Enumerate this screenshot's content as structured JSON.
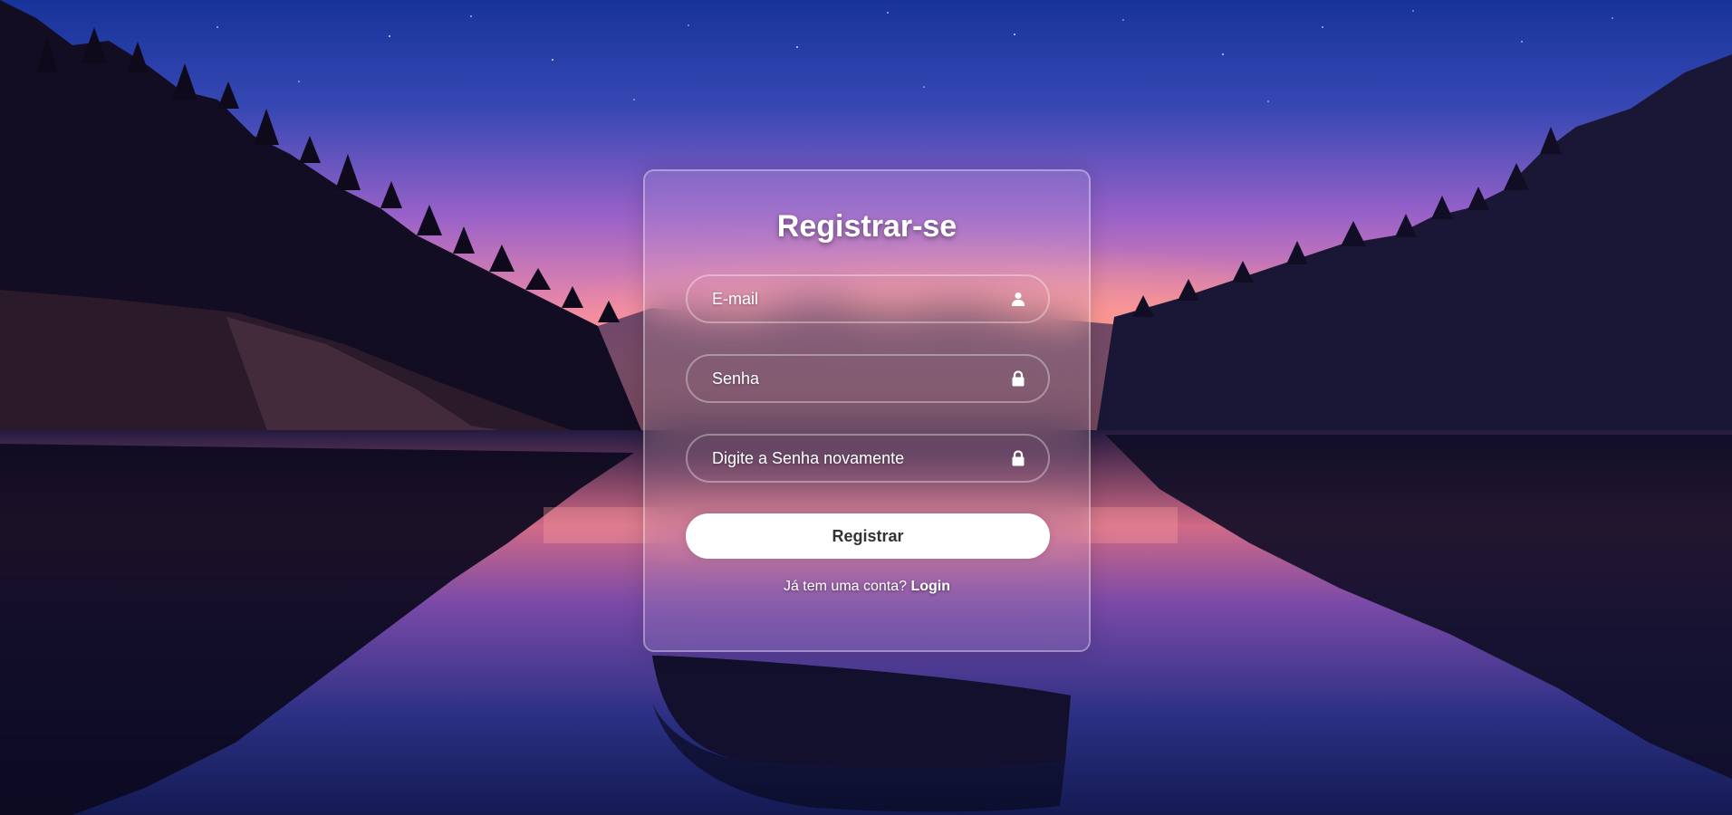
{
  "form": {
    "title": "Registrar-se",
    "email": {
      "placeholder": "E-mail",
      "icon": "user-icon"
    },
    "password": {
      "placeholder": "Senha",
      "icon": "lock-icon"
    },
    "confirm_password": {
      "placeholder": "Digite a Senha novamente",
      "icon": "lock-icon"
    },
    "submit_label": "Registrar",
    "switch_prompt": "Já tem uma conta?",
    "switch_link": "Login"
  },
  "colors": {
    "sky_top": "#1d3fa0",
    "sky_mid": "#7a55c9",
    "horizon": "#f3899c",
    "button_bg": "#ffffff",
    "button_text": "#333333",
    "text": "#ffffff"
  },
  "background": {
    "scene": "mountain-lake-sunset",
    "elements": [
      "star-icon",
      "pine-trees",
      "rowboat"
    ]
  }
}
